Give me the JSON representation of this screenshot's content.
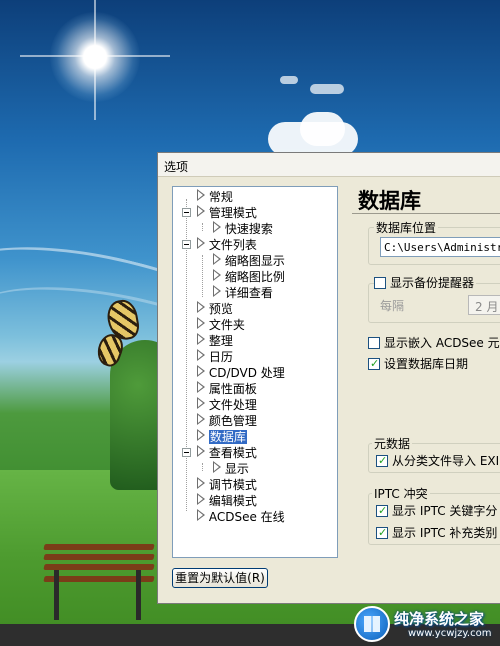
{
  "dialog": {
    "title": "选项",
    "reset_button": "重置为默认值(R)"
  },
  "tree": {
    "items": [
      {
        "label": "常规"
      },
      {
        "label": "管理模式"
      },
      {
        "label": "快速搜索"
      },
      {
        "label": "文件列表"
      },
      {
        "label": "缩略图显示"
      },
      {
        "label": "缩略图比例"
      },
      {
        "label": "详细查看"
      },
      {
        "label": "预览"
      },
      {
        "label": "文件夹"
      },
      {
        "label": "整理"
      },
      {
        "label": "日历"
      },
      {
        "label": "CD/DVD 处理"
      },
      {
        "label": "属性面板"
      },
      {
        "label": "文件处理"
      },
      {
        "label": "颜色管理"
      },
      {
        "label": "数据库",
        "selected": true
      },
      {
        "label": "查看模式"
      },
      {
        "label": "显示"
      },
      {
        "label": "调节模式"
      },
      {
        "label": "编辑模式"
      },
      {
        "label": "ACDSee 在线"
      }
    ]
  },
  "page": {
    "title": "数据库",
    "db_location_label": "数据库位置",
    "db_path": "C:\\Users\\Administrat",
    "backup_reminder_label": "显示备份提醒器",
    "backup_reminder_checked": false,
    "every_label": "每隔",
    "interval_value": "2 月",
    "embedded_label": "显示嵌入 ACDSee 元数",
    "embedded_checked": false,
    "set_db_date_label": "设置数据库日期",
    "set_db_date_checked": true,
    "metadata_label": "元数据",
    "import_exif_label": "从分类文件导入 EXI",
    "import_exif_checked": true,
    "iptc_conflict_label": "IPTC 冲突",
    "iptc_keywords_label": "显示 IPTC 关键字分",
    "iptc_keywords_checked": true,
    "iptc_supplemental_label": "显示 IPTC 补充类别",
    "iptc_supplemental_checked": true
  },
  "watermark": {
    "title": "纯净系统之家",
    "url": "www.ycwjzy.com"
  },
  "colors": {
    "dialog_bg": "#ece9d8",
    "selection": "#316ac5"
  }
}
